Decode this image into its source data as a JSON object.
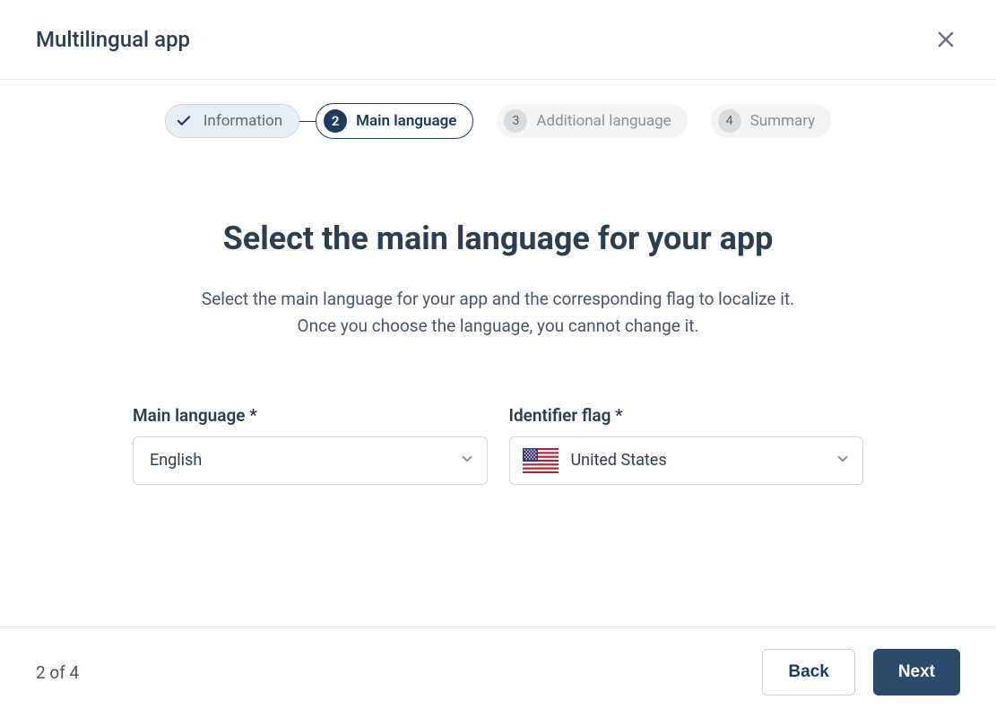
{
  "modal": {
    "title": "Multilingual app"
  },
  "stepper": {
    "steps": [
      {
        "label": "Information"
      },
      {
        "number": "2",
        "label": "Main language"
      },
      {
        "number": "3",
        "label": "Additional language"
      },
      {
        "number": "4",
        "label": "Summary"
      }
    ]
  },
  "content": {
    "heading": "Select the main language for your app",
    "subtitle_line1": "Select the main language for your app and the corresponding flag to localize it.",
    "subtitle_line2": "Once you choose the language, you cannot change it."
  },
  "form": {
    "language_label": "Main language *",
    "language_value": "English",
    "flag_label": "Identifier flag *",
    "flag_value": "United States"
  },
  "footer": {
    "step_indicator": "2 of 4",
    "back_label": "Back",
    "next_label": "Next"
  }
}
